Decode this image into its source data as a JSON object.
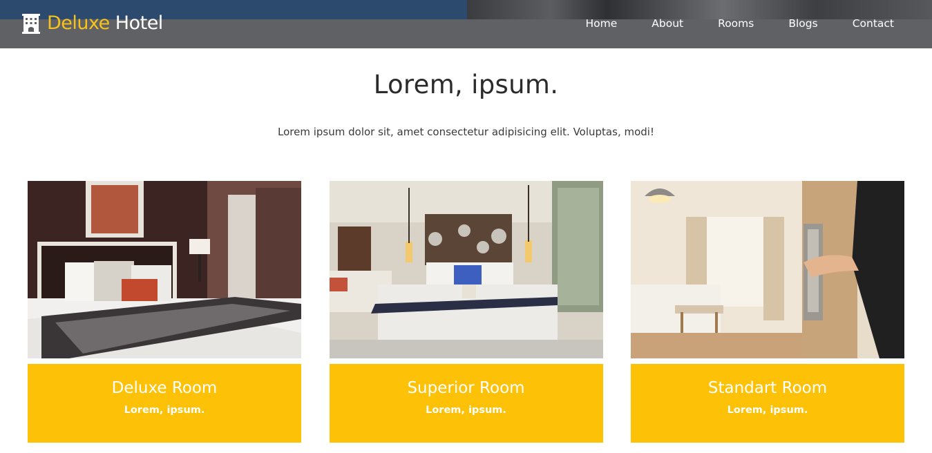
{
  "brand": {
    "word1": "Deluxe",
    "word2": "Hotel",
    "icon": "hotel-building-icon"
  },
  "nav": [
    {
      "label": "Home"
    },
    {
      "label": "About"
    },
    {
      "label": "Rooms"
    },
    {
      "label": "Blogs"
    },
    {
      "label": "Contact"
    }
  ],
  "section": {
    "title": "Lorem, ipsum.",
    "subtitle": "Lorem ipsum dolor sit, amet consectetur adipisicing elit. Voluptas, modi!"
  },
  "rooms": [
    {
      "title": "Deluxe Room",
      "subtitle": "Lorem, ipsum."
    },
    {
      "title": "Superior Room",
      "subtitle": "Lorem, ipsum."
    },
    {
      "title": "Standart Room",
      "subtitle": "Lorem, ipsum."
    }
  ],
  "colors": {
    "accent": "#fdc107",
    "brand_yellow": "#f7c21b",
    "navbar": "#5c5e62"
  }
}
